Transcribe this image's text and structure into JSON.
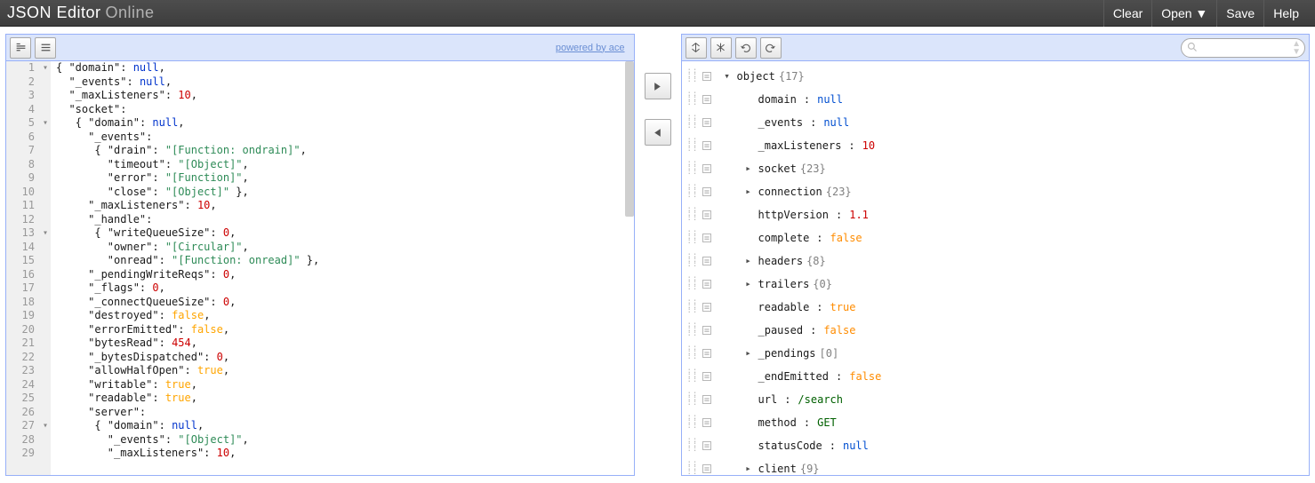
{
  "app": {
    "title_main": "JSON Editor",
    "title_sub": "Online"
  },
  "menu": {
    "clear": "Clear",
    "open": "Open ▼",
    "save": "Save",
    "help": "Help"
  },
  "left_toolbar": {
    "powered": "powered by ace"
  },
  "code_lines": [
    {
      "n": 1,
      "fold": "▾",
      "html": "<span class='tok-punc'>{ </span><span class='tok-name'>\"domain\"</span><span class='tok-punc'>: </span><span class='tok-null'>null</span><span class='tok-punc'>,</span>"
    },
    {
      "n": 2,
      "fold": "",
      "html": "  <span class='tok-name'>\"_events\"</span><span class='tok-punc'>: </span><span class='tok-null'>null</span><span class='tok-punc'>,</span>"
    },
    {
      "n": 3,
      "fold": "",
      "html": "  <span class='tok-name'>\"_maxListeners\"</span><span class='tok-punc'>: </span><span class='tok-num'>10</span><span class='tok-punc'>,</span>"
    },
    {
      "n": 4,
      "fold": "",
      "html": "  <span class='tok-name'>\"socket\"</span><span class='tok-punc'>:</span>"
    },
    {
      "n": 5,
      "fold": "▾",
      "html": "   <span class='tok-punc'>{ </span><span class='tok-name'>\"domain\"</span><span class='tok-punc'>: </span><span class='tok-null'>null</span><span class='tok-punc'>,</span>"
    },
    {
      "n": 6,
      "fold": "",
      "html": "     <span class='tok-name'>\"_events\"</span><span class='tok-punc'>:</span>"
    },
    {
      "n": 7,
      "fold": "",
      "html": "      <span class='tok-punc'>{ </span><span class='tok-name'>\"drain\"</span><span class='tok-punc'>: </span><span class='tok-string'>\"[Function: ondrain]\"</span><span class='tok-punc'>,</span>"
    },
    {
      "n": 8,
      "fold": "",
      "html": "        <span class='tok-name'>\"timeout\"</span><span class='tok-punc'>: </span><span class='tok-string'>\"[Object]\"</span><span class='tok-punc'>,</span>"
    },
    {
      "n": 9,
      "fold": "",
      "html": "        <span class='tok-name'>\"error\"</span><span class='tok-punc'>: </span><span class='tok-string'>\"[Function]\"</span><span class='tok-punc'>,</span>"
    },
    {
      "n": 10,
      "fold": "",
      "html": "        <span class='tok-name'>\"close\"</span><span class='tok-punc'>: </span><span class='tok-string'>\"[Object]\"</span><span class='tok-punc'> },</span>"
    },
    {
      "n": 11,
      "fold": "",
      "html": "     <span class='tok-name'>\"_maxListeners\"</span><span class='tok-punc'>: </span><span class='tok-num'>10</span><span class='tok-punc'>,</span>"
    },
    {
      "n": 12,
      "fold": "",
      "html": "     <span class='tok-name'>\"_handle\"</span><span class='tok-punc'>:</span>"
    },
    {
      "n": 13,
      "fold": "▾",
      "html": "      <span class='tok-punc'>{ </span><span class='tok-name'>\"writeQueueSize\"</span><span class='tok-punc'>: </span><span class='tok-num'>0</span><span class='tok-punc'>,</span>"
    },
    {
      "n": 14,
      "fold": "",
      "html": "        <span class='tok-name'>\"owner\"</span><span class='tok-punc'>: </span><span class='tok-string'>\"[Circular]\"</span><span class='tok-punc'>,</span>"
    },
    {
      "n": 15,
      "fold": "",
      "html": "        <span class='tok-name'>\"onread\"</span><span class='tok-punc'>: </span><span class='tok-string'>\"[Function: onread]\"</span><span class='tok-punc'> },</span>"
    },
    {
      "n": 16,
      "fold": "",
      "html": "     <span class='tok-name'>\"_pendingWriteReqs\"</span><span class='tok-punc'>: </span><span class='tok-num'>0</span><span class='tok-punc'>,</span>"
    },
    {
      "n": 17,
      "fold": "",
      "html": "     <span class='tok-name'>\"_flags\"</span><span class='tok-punc'>: </span><span class='tok-num'>0</span><span class='tok-punc'>,</span>"
    },
    {
      "n": 18,
      "fold": "",
      "html": "     <span class='tok-name'>\"_connectQueueSize\"</span><span class='tok-punc'>: </span><span class='tok-num'>0</span><span class='tok-punc'>,</span>"
    },
    {
      "n": 19,
      "fold": "",
      "html": "     <span class='tok-name'>\"destroyed\"</span><span class='tok-punc'>: </span><span class='tok-bool'>false</span><span class='tok-punc'>,</span>"
    },
    {
      "n": 20,
      "fold": "",
      "html": "     <span class='tok-name'>\"errorEmitted\"</span><span class='tok-punc'>: </span><span class='tok-bool'>false</span><span class='tok-punc'>,</span>"
    },
    {
      "n": 21,
      "fold": "",
      "html": "     <span class='tok-name'>\"bytesRead\"</span><span class='tok-punc'>: </span><span class='tok-num'>454</span><span class='tok-punc'>,</span>"
    },
    {
      "n": 22,
      "fold": "",
      "html": "     <span class='tok-name'>\"_bytesDispatched\"</span><span class='tok-punc'>: </span><span class='tok-num'>0</span><span class='tok-punc'>,</span>"
    },
    {
      "n": 23,
      "fold": "",
      "html": "     <span class='tok-name'>\"allowHalfOpen\"</span><span class='tok-punc'>: </span><span class='tok-bool'>true</span><span class='tok-punc'>,</span>"
    },
    {
      "n": 24,
      "fold": "",
      "html": "     <span class='tok-name'>\"writable\"</span><span class='tok-punc'>: </span><span class='tok-bool'>true</span><span class='tok-punc'>,</span>"
    },
    {
      "n": 25,
      "fold": "",
      "html": "     <span class='tok-name'>\"readable\"</span><span class='tok-punc'>: </span><span class='tok-bool'>true</span><span class='tok-punc'>,</span>"
    },
    {
      "n": 26,
      "fold": "",
      "html": "     <span class='tok-name'>\"server\"</span><span class='tok-punc'>:</span>"
    },
    {
      "n": 27,
      "fold": "▾",
      "html": "      <span class='tok-punc'>{ </span><span class='tok-name'>\"domain\"</span><span class='tok-punc'>: </span><span class='tok-null'>null</span><span class='tok-punc'>,</span>"
    },
    {
      "n": 28,
      "fold": "",
      "html": "        <span class='tok-name'>\"_events\"</span><span class='tok-punc'>: </span><span class='tok-string'>\"[Object]\"</span><span class='tok-punc'>,</span>"
    },
    {
      "n": 29,
      "fold": "",
      "html": "        <span class='tok-name'>\"_maxListeners\"</span><span class='tok-punc'>: </span><span class='tok-num'>10</span><span class='tok-punc'>,</span>"
    }
  ],
  "tree": [
    {
      "depth": 0,
      "exp": "▾",
      "key": "object",
      "meta": "{17}",
      "val": null,
      "vtype": null
    },
    {
      "depth": 1,
      "exp": "",
      "key": "domain",
      "meta": "",
      "val": "null",
      "vtype": "null"
    },
    {
      "depth": 1,
      "exp": "",
      "key": "_events",
      "meta": "",
      "val": "null",
      "vtype": "null"
    },
    {
      "depth": 1,
      "exp": "",
      "key": "_maxListeners",
      "meta": "",
      "val": "10",
      "vtype": "number"
    },
    {
      "depth": 1,
      "exp": "▸",
      "key": "socket",
      "meta": "{23}",
      "val": null,
      "vtype": null
    },
    {
      "depth": 1,
      "exp": "▸",
      "key": "connection",
      "meta": "{23}",
      "val": null,
      "vtype": null
    },
    {
      "depth": 1,
      "exp": "",
      "key": "httpVersion",
      "meta": "",
      "val": "1.1",
      "vtype": "number"
    },
    {
      "depth": 1,
      "exp": "",
      "key": "complete",
      "meta": "",
      "val": "false",
      "vtype": "bool"
    },
    {
      "depth": 1,
      "exp": "▸",
      "key": "headers",
      "meta": "{8}",
      "val": null,
      "vtype": null
    },
    {
      "depth": 1,
      "exp": "▸",
      "key": "trailers",
      "meta": "{0}",
      "val": null,
      "vtype": null
    },
    {
      "depth": 1,
      "exp": "",
      "key": "readable",
      "meta": "",
      "val": "true",
      "vtype": "bool"
    },
    {
      "depth": 1,
      "exp": "",
      "key": "_paused",
      "meta": "",
      "val": "false",
      "vtype": "bool"
    },
    {
      "depth": 1,
      "exp": "▸",
      "key": "_pendings",
      "meta": "[0]",
      "val": null,
      "vtype": null
    },
    {
      "depth": 1,
      "exp": "",
      "key": "_endEmitted",
      "meta": "",
      "val": "false",
      "vtype": "bool"
    },
    {
      "depth": 1,
      "exp": "",
      "key": "url",
      "meta": "",
      "val": "/search",
      "vtype": "string"
    },
    {
      "depth": 1,
      "exp": "",
      "key": "method",
      "meta": "",
      "val": "GET",
      "vtype": "string"
    },
    {
      "depth": 1,
      "exp": "",
      "key": "statusCode",
      "meta": "",
      "val": "null",
      "vtype": "null"
    },
    {
      "depth": 1,
      "exp": "▸",
      "key": "client",
      "meta": "{9}",
      "val": null,
      "vtype": null
    }
  ]
}
